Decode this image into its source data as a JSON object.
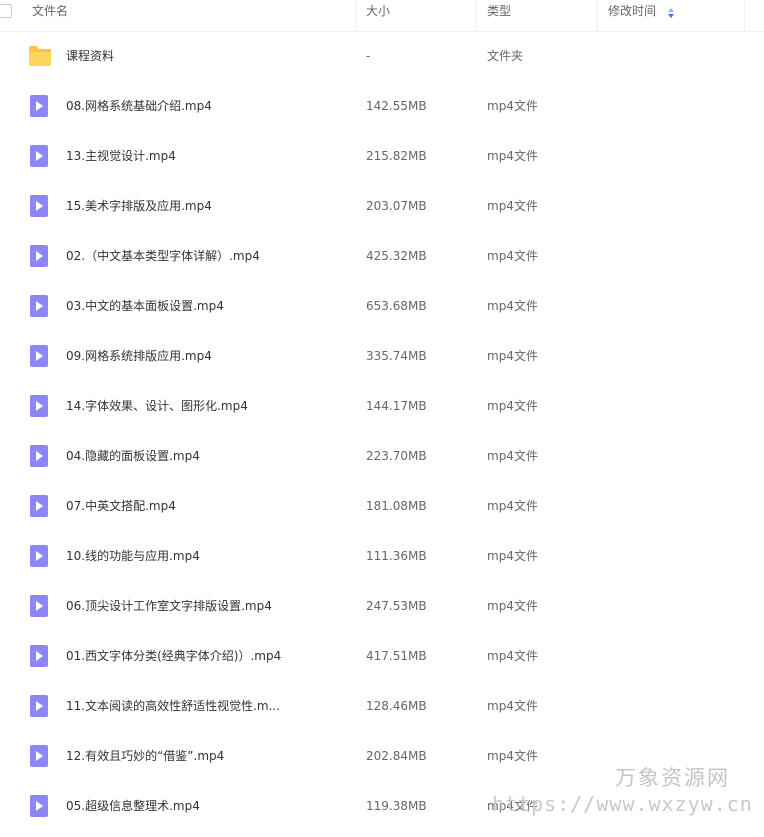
{
  "header": {
    "col_name": "文件名",
    "col_size": "大小",
    "col_type": "类型",
    "col_modified": "修改时间"
  },
  "files": [
    {
      "icon": "folder-icon",
      "name": "课程资料",
      "size": "-",
      "type": "文件夹"
    },
    {
      "icon": "video-file-icon",
      "name": "08.网格系统基础介绍.mp4",
      "size": "142.55MB",
      "type": "mp4文件"
    },
    {
      "icon": "video-file-icon",
      "name": "13.主视觉设计.mp4",
      "size": "215.82MB",
      "type": "mp4文件"
    },
    {
      "icon": "video-file-icon",
      "name": "15.美术字排版及应用.mp4",
      "size": "203.07MB",
      "type": "mp4文件"
    },
    {
      "icon": "video-file-icon",
      "name": "02.（中文基本类型字体详解）.mp4",
      "size": "425.32MB",
      "type": "mp4文件"
    },
    {
      "icon": "video-file-icon",
      "name": "03.中文的基本面板设置.mp4",
      "size": "653.68MB",
      "type": "mp4文件"
    },
    {
      "icon": "video-file-icon",
      "name": "09.网格系统排版应用.mp4",
      "size": "335.74MB",
      "type": "mp4文件"
    },
    {
      "icon": "video-file-icon",
      "name": "14.字体效果、设计、图形化.mp4",
      "size": "144.17MB",
      "type": "mp4文件"
    },
    {
      "icon": "video-file-icon",
      "name": "04.隐藏的面板设置.mp4",
      "size": "223.70MB",
      "type": "mp4文件"
    },
    {
      "icon": "video-file-icon",
      "name": "07.中英文搭配.mp4",
      "size": "181.08MB",
      "type": "mp4文件"
    },
    {
      "icon": "video-file-icon",
      "name": "10.线的功能与应用.mp4",
      "size": "111.36MB",
      "type": "mp4文件"
    },
    {
      "icon": "video-file-icon",
      "name": "06.顶尖设计工作室文字排版设置.mp4",
      "size": "247.53MB",
      "type": "mp4文件"
    },
    {
      "icon": "video-file-icon",
      "name": "01.西文字体分类(经典字体介绍)）.mp4",
      "size": "417.51MB",
      "type": "mp4文件"
    },
    {
      "icon": "video-file-icon",
      "name": "11.文本阅读的高效性舒适性视觉性.m...",
      "size": "128.46MB",
      "type": "mp4文件"
    },
    {
      "icon": "video-file-icon",
      "name": "12.有效且巧妙的“借鉴”.mp4",
      "size": "202.84MB",
      "type": "mp4文件"
    },
    {
      "icon": "video-file-icon",
      "name": "05.超级信息整理术.mp4",
      "size": "119.38MB",
      "type": "mp4文件"
    }
  ],
  "watermark": {
    "text_cn": "万象资源网",
    "text_url": "https://www.wxzyw.cn"
  },
  "colors": {
    "folder": "#f8c63a",
    "video_icon": "#8d86f5",
    "sort_active": "#2f7cf6"
  }
}
